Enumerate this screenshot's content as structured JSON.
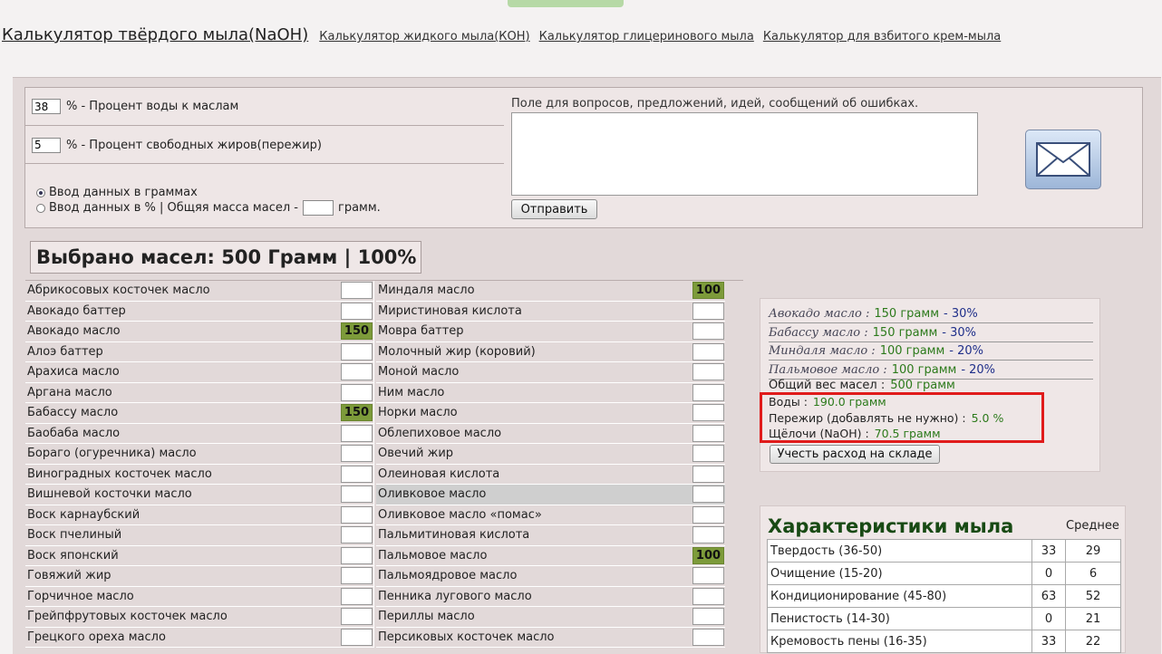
{
  "nav": {
    "active": "Калькулятор твёрдого мыла(NaOH)",
    "links": [
      "Калькулятор жидкого мыла(КОН)",
      "Калькулятор глицеринового мыла",
      "Калькулятор для взбитого крем-мыла"
    ]
  },
  "settings": {
    "water_value": "38",
    "water_label": "% - Процент воды к маслам",
    "superfat_value": "5",
    "superfat_label": "% - Процент свободных жиров(пережир)",
    "radio_grams": "Ввод данных в граммах",
    "radio_percent": "Ввод данных в % | Общяя масса масел -",
    "grams_unit": "грамм.",
    "selected_mode": "grams"
  },
  "feedback": {
    "label": "Поле для вопросов, предложений, идей, сообщений об ошибках.",
    "send": "Отправить",
    "icon": "envelope-icon"
  },
  "selected_summary": "Выбрано масел: 500 Грамм | 100%",
  "oils_left": [
    {
      "name": "Абрикосовых косточек масло",
      "qty": ""
    },
    {
      "name": "Авокадо баттер",
      "qty": ""
    },
    {
      "name": "Авокадо масло",
      "qty": "150"
    },
    {
      "name": "Алоэ баттер",
      "qty": ""
    },
    {
      "name": "Арахиса масло",
      "qty": ""
    },
    {
      "name": "Аргана масло",
      "qty": ""
    },
    {
      "name": "Бабассу масло",
      "qty": "150"
    },
    {
      "name": "Баобаба масло",
      "qty": ""
    },
    {
      "name": "Бораго (огуречника) масло",
      "qty": ""
    },
    {
      "name": "Виноградных косточек масло",
      "qty": ""
    },
    {
      "name": "Вишневой косточки масло",
      "qty": ""
    },
    {
      "name": "Воск карнаубский",
      "qty": ""
    },
    {
      "name": "Воск пчелиный",
      "qty": ""
    },
    {
      "name": "Воск японский",
      "qty": ""
    },
    {
      "name": "Говяжий жир",
      "qty": ""
    },
    {
      "name": "Горчичное масло",
      "qty": ""
    },
    {
      "name": "Грейпфрутовых косточек масло",
      "qty": ""
    },
    {
      "name": "Грецкого ореха масло",
      "qty": ""
    }
  ],
  "oils_right": [
    {
      "name": "Миндаля масло",
      "qty": "100"
    },
    {
      "name": "Миристиновая кислота",
      "qty": ""
    },
    {
      "name": "Мовра баттер",
      "qty": ""
    },
    {
      "name": "Молочный жир (коровий)",
      "qty": ""
    },
    {
      "name": "Моной масло",
      "qty": ""
    },
    {
      "name": "Ним масло",
      "qty": ""
    },
    {
      "name": "Норки масло",
      "qty": ""
    },
    {
      "name": "Облепиховое масло",
      "qty": ""
    },
    {
      "name": "Овечий жир",
      "qty": ""
    },
    {
      "name": "Олеиновая кислота",
      "qty": ""
    },
    {
      "name": "Оливковое масло",
      "qty": "",
      "highlighted": true
    },
    {
      "name": "Оливковое масло «помас»",
      "qty": ""
    },
    {
      "name": "Пальмитиновая кислота",
      "qty": ""
    },
    {
      "name": "Пальмовое масло",
      "qty": "100"
    },
    {
      "name": "Пальмоядровое масло",
      "qty": ""
    },
    {
      "name": "Пенника лугового масло",
      "qty": ""
    },
    {
      "name": "Периллы масло",
      "qty": ""
    },
    {
      "name": "Персиковых косточек масло",
      "qty": ""
    }
  ],
  "summary": {
    "lines": [
      {
        "name": "Авокадо масло :",
        "amount": "150 грамм",
        "pct": "- 30%"
      },
      {
        "name": "Бабассу масло :",
        "amount": "150 грамм",
        "pct": "- 30%"
      },
      {
        "name": "Миндаля масло :",
        "amount": "100 грамм",
        "pct": "- 20%"
      },
      {
        "name": "Пальмовое масло :",
        "amount": "100 грамм",
        "pct": "- 20%"
      }
    ],
    "total_label": "Общий вес масел :",
    "total_value": "500 грамм",
    "water_label": "Воды :",
    "water_value": "190.0 грамм",
    "superfat_label": "Пережир (добавлять не нужно) :",
    "superfat_value": "5.0 %",
    "lye_label": "Щёлочи (NaOH) :",
    "lye_value": "70.5 грамм",
    "stock_button": "Учесть расход на складе"
  },
  "properties": {
    "title": "Характеристики мыла",
    "avg_header": "Среднее",
    "rows": [
      {
        "name": "Твердость (36-50)",
        "value": "33",
        "avg": "29"
      },
      {
        "name": "Очищение (15-20)",
        "value": "0",
        "avg": "6"
      },
      {
        "name": "Кондиционирование (45-80)",
        "value": "63",
        "avg": "52"
      },
      {
        "name": "Пенистость (14-30)",
        "value": "0",
        "avg": "21"
      },
      {
        "name": "Кремовость пены (16-35)",
        "value": "33",
        "avg": "22"
      }
    ]
  },
  "colors": {
    "filled_qty": "#7d9b3a",
    "amount_green": "#2c7a1b",
    "pct_blue": "#1f2f8a",
    "highlight_box": "#e01b1b",
    "props_title": "#184a14"
  }
}
